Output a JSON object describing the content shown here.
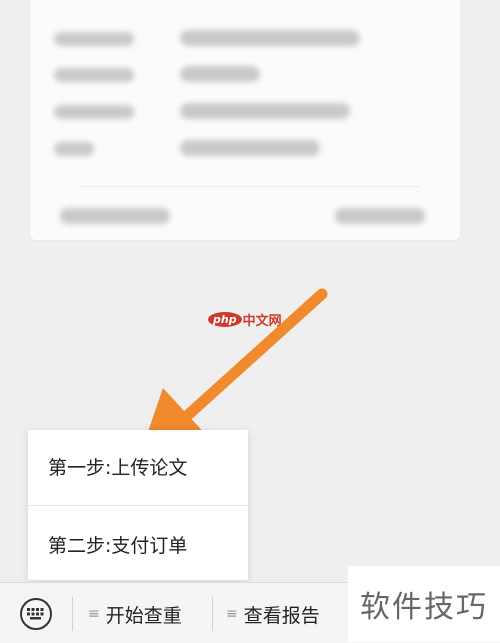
{
  "watermark": {
    "logo": "php",
    "text": "中文网"
  },
  "popup_menu": {
    "items": [
      {
        "label": "第一步:上传论文"
      },
      {
        "label": "第二步:支付订单"
      }
    ]
  },
  "bottom_bar": {
    "keyboard_icon": "keyboard-icon",
    "tabs": [
      {
        "label": "开始查重",
        "icon": "menu-icon"
      },
      {
        "label": "查看报告",
        "icon": "menu-icon"
      }
    ]
  },
  "brand_watermark": {
    "text": "软件技巧"
  },
  "colors": {
    "arrow": "#f08a2c",
    "php_red": "#cf3a2a"
  }
}
